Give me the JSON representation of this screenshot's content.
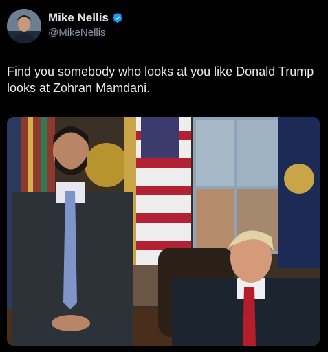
{
  "tweet": {
    "author_name": "Mike Nellis",
    "author_handle": "@MikeNellis",
    "verified": true,
    "text": "Find you somebody who looks at you like Donald Trump looks at Zohran Mamdani."
  },
  "colors": {
    "background": "#000000",
    "text": "#e7e9ea",
    "handle": "#8b98a5",
    "verified_badge": "#1d9bf0"
  },
  "icons": {
    "verified": "verified-badge-icon"
  }
}
